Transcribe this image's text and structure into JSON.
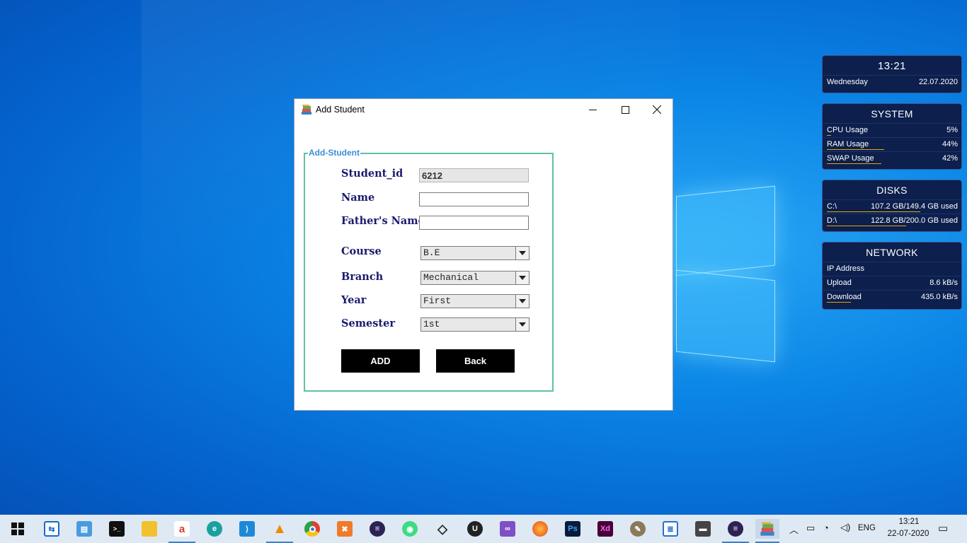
{
  "desktop": {
    "widgets": {
      "clock": {
        "time": "13:21",
        "day": "Wednesday",
        "date": "22.07.2020"
      },
      "system": {
        "title": "SYSTEM",
        "rows": [
          {
            "label": "CPU Usage",
            "value": "5%",
            "fill": 0.05
          },
          {
            "label": "RAM Usage",
            "value": "44%",
            "fill": 0.44
          },
          {
            "label": "SWAP Usage",
            "value": "42%",
            "fill": 0.42
          }
        ]
      },
      "disks": {
        "title": "DISKS",
        "rows": [
          {
            "label": "C:\\",
            "value": "107.2 GB/149.4 GB used",
            "fill": 0.72
          },
          {
            "label": "D:\\",
            "value": "122.8 GB/200.0 GB used",
            "fill": 0.61
          }
        ]
      },
      "network": {
        "title": "NETWORK",
        "rows": [
          {
            "label": "IP Address",
            "value": ""
          },
          {
            "label": "Upload",
            "value": "8.6 kB/s"
          },
          {
            "label": "Download",
            "value": "435.0 kB/s"
          }
        ]
      }
    }
  },
  "window": {
    "title": "Add Student",
    "form": {
      "legend": "Add-Student",
      "student_id": {
        "label": "Student_id",
        "value": "6212"
      },
      "name": {
        "label": "Name",
        "value": ""
      },
      "fathers_name": {
        "label": "Father's Name",
        "value": ""
      },
      "course": {
        "label": "Course",
        "selected": "B.E"
      },
      "branch": {
        "label": "Branch",
        "selected": "Mechanical"
      },
      "year": {
        "label": "Year",
        "selected": "First"
      },
      "semester": {
        "label": "Semester",
        "selected": "1st"
      },
      "add_label": "ADD",
      "back_label": "Back"
    }
  },
  "taskbar": {
    "apps": [
      "start-icon",
      "teamviewer-icon",
      "control-panel-icon",
      "terminal-icon",
      "file-explorer-icon",
      "acrobat-icon",
      "edge-icon",
      "vscode-icon",
      "vlc-icon",
      "chrome-icon",
      "xampp-icon",
      "eclipse-icon",
      "android-studio-icon",
      "unity-icon",
      "unreal-icon",
      "visual-studio-icon",
      "firefox-icon",
      "photoshop-icon",
      "adobe-xd-icon",
      "gimp-icon",
      "notepad-icon",
      "mysql-icon",
      "eclipse2-icon",
      "student-app-icon"
    ],
    "tray": {
      "language": "ENG",
      "time": "13:21",
      "date": "22-07-2020"
    }
  }
}
